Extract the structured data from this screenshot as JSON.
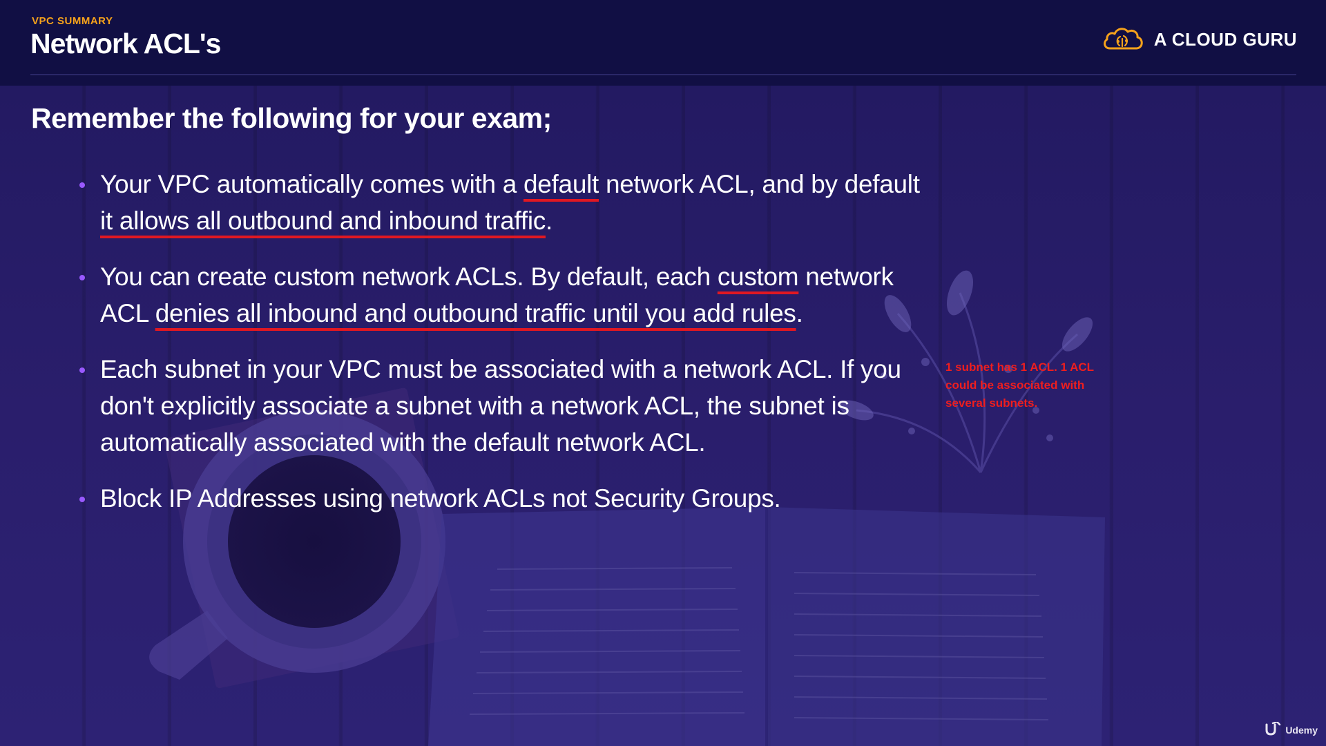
{
  "header": {
    "section_label": "VPC SUMMARY",
    "title": "Network ACL's",
    "brand": "A CLOUD GURU"
  },
  "content": {
    "heading": "Remember the following for your exam;",
    "bullets": [
      {
        "p1": "Your VPC automatically comes with a ",
        "u1": "default",
        "p2": " network ACL, and by default",
        "u2": " it allows all outbound and inbound traffic",
        "p3": "."
      },
      {
        "p1": "You can create custom network ACLs. By default, each ",
        "u1": "custom",
        "p2": " network ACL ",
        "u2": "denies all inbound and outbound traffic until you add rules",
        "p3": "."
      },
      {
        "text": "Each subnet in your VPC must be associated with a network ACL. If you don't explicitly associate a subnet with a network ACL, the subnet is automatically associated with the default network ACL."
      },
      {
        "text": "Block IP Addresses using network ACLs not Security Groups."
      }
    ],
    "annotation": "1 subnet has 1 ACL. 1 ACL could be associated with several subnets."
  },
  "watermark": {
    "label": "Udemy"
  },
  "icons": {
    "brand_logo": "cloud-icon",
    "watermark_logo": "udemy-u-icon"
  },
  "colors": {
    "header_bg": "#110f44",
    "accent_orange": "#f6a21b",
    "bullet_purple": "#9a59ff",
    "underline_red": "#e01822",
    "annotation_red": "#ef1e1e"
  }
}
